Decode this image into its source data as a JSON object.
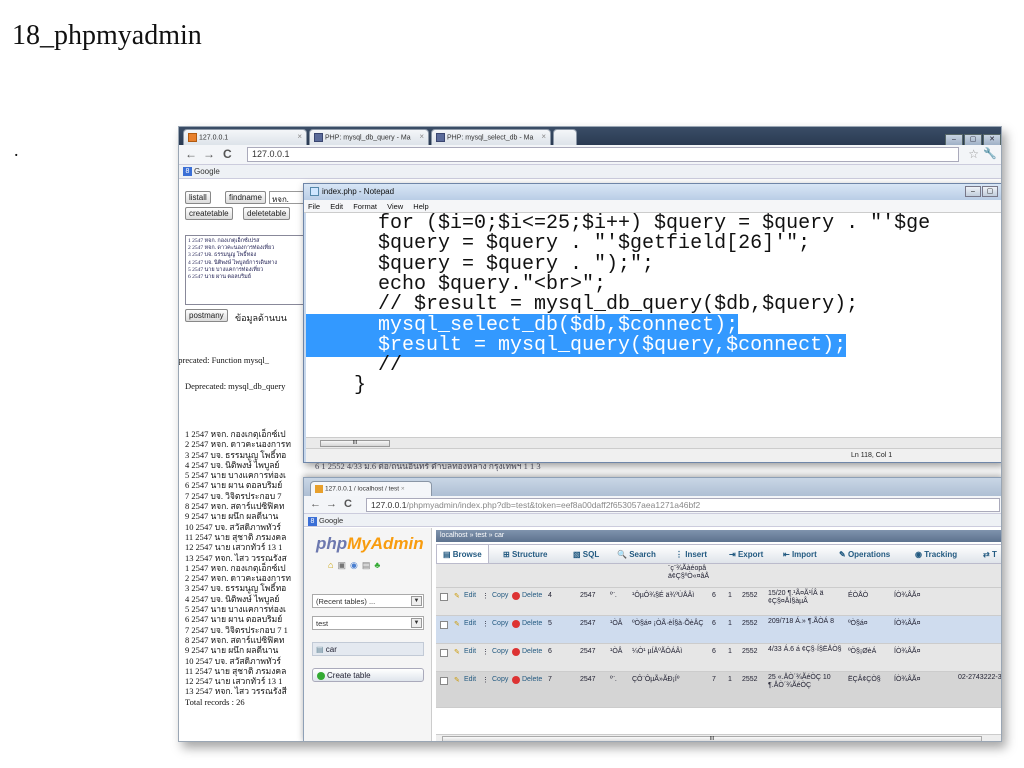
{
  "slide": {
    "title": "18_phpmyadmin",
    "bullet": "."
  },
  "browser": {
    "tabs": [
      {
        "label": "127.0.0.1"
      },
      {
        "label": "PHP: mysql_db_query - Ma"
      },
      {
        "label": "PHP: mysql_select_db - Ma"
      }
    ],
    "url": "127.0.0.1",
    "bookmark": "Google",
    "nav_back": "←",
    "nav_forward": "→",
    "nav_reload": "C"
  },
  "back_page": {
    "buttons": {
      "listall": "listall",
      "findname": "findname",
      "createtable": "createtable",
      "deletetable": "deletetable",
      "postmany": "postmany"
    },
    "find_input": "หจก.",
    "listbox_items": [
      "1 2547 หจก. กองเกตุเอ็กซ์เปรส",
      "2 2547 หจก. ดาวคะนองการท่องเที่ยว",
      "3 2547 บจ. ธรรมนูญ โพธิ์ทอง",
      "4 2547 บจ. นิติพงษ์ ไพบูลย์การเดินทาง",
      "5 2547 นาย บางแคการท่องเที่ยว",
      "6 2547 นาย ผาน ตอลบริมย์"
    ],
    "postmany_label": "ข้อมูลด้านบน",
    "deprecated_1": "Deprecated: Function mysql_",
    "deprecated_2": "Deprecated: mysql_db_query",
    "line_6_tail": "6 1 2552 4/33 ม.6 ต่อ/ถนนอินทร์ ตำบลทองหลาง กรุงเทพฯ 1 1 3",
    "records": [
      "1 2547 หจก. กองเกตุเอ็กซ์เป",
      "2 2547 หจก. ดาวคะนองการท",
      "3 2547 บจ. ธรรมนูญ โพธิ์ทอ",
      "4 2547 บจ. นิติพงษ์ ไพบูลย์",
      "5 2547 นาย บางแคการท่องเ",
      "6 2547 นาย ผาน ตอลบริมย์",
      "7 2547 บจ. วิจิตรประกอบ 7",
      "8 2547 หจก. สตาร์แปซิฟิคท",
      "9 2547 นาย ผนึก ผลดีนาน",
      "10 2547 บจ. สวัสดิภาพทัวร์",
      "11 2547 นาย สุชาติ ภรมงคล",
      "12 2547 นาย เสวกทัวร์ 13 1",
      "13 2547 หจก. ไสว วรรณรังส",
      "1 2547 หจก. กองเกตุเอ็กซ์เป",
      "2 2547 หจก. ดาวคะนองการท",
      "3 2547 บจ. ธรรมนูญ โพธิ์ทอ",
      "4 2547 บจ. นิติพงษ์ ไพบูลย์",
      "5 2547 นาย บางแคการท่องเ",
      "6 2547 นาย ผาน ตอลบริมย์",
      "7 2547 บจ. วิจิตรประกอบ 7 1",
      "8 2547 หจก. สตาร์แปซิฟิคท",
      "9 2547 นาย ผนึก ผลดีนาน",
      "10 2547 บจ. สวัสดิภาพทัวร์",
      "11 2547 นาย สุชาติ ภรมงคล",
      "12 2547 นาย เสวกทัวร์ 13 1",
      "13 2547 หจก. ไสว วรรณรังสี",
      "Total records : 26"
    ]
  },
  "notepad": {
    "title": "index.php - Notepad",
    "menu": [
      "File",
      "Edit",
      "Format",
      "View",
      "Help"
    ],
    "lines": [
      {
        "text": "      for ($i=0;$i<=25;$i++) $query = $query . \"'$ge",
        "selected": false
      },
      {
        "text": "      $query = $query . \"'$getfield[26]'\";",
        "selected": false
      },
      {
        "text": "      $query = $query . \");\";",
        "selected": false
      },
      {
        "text": "      echo $query.\"<br>\";",
        "selected": false
      },
      {
        "text": "      // $result = mysql_db_query($db,$query);",
        "selected": false
      },
      {
        "text": "      mysql_select_db($db,$connect);",
        "selected": true
      },
      {
        "text": "      $result = mysql_query($query,$connect);",
        "selected": true
      },
      {
        "text": "      //",
        "selected": false
      },
      {
        "text": "    }",
        "selected": false
      }
    ],
    "scroll_thumb": "III",
    "status": "Ln 118, Col 1"
  },
  "pma": {
    "tab_label": "127.0.0.1 / localhost / test",
    "url_host": "127.0.0.1",
    "url_path": "/phpmyadmin/index.php?db=test&token=eef8a00daff2f653057aea1271a46bf2",
    "bookmark": "Google",
    "logo_php": "php",
    "logo_my": "MyAdmin",
    "recent_tables": "(Recent tables) ...",
    "db_select": "test",
    "table_item": "car",
    "create_table": "Create table",
    "breadcrumb": "localhost » test » car",
    "menu": [
      "Browse",
      "Structure",
      "SQL",
      "Search",
      "Insert",
      "Export",
      "Import",
      "Operations",
      "Tracking",
      "T"
    ],
    "row_actions": {
      "edit": "Edit",
      "copy": "Copy",
      "delete": "Delete"
    },
    "top_fragment": [
      "¨ç¨¾Ãàéopâ",
      "ä¢Ç§ºÒ«¤âÅ"
    ],
    "rows": [
      {
        "id": "4",
        "year": "2547",
        "c1": "º¨.",
        "c2": "¹ÔµÔ¾§É ä¾ºÙÅÂì",
        "c3": "6",
        "c4": "1",
        "c5": "2552",
        "addr": "15/20 ¶.¹Ã¤Ã¹ÍÂ ä ¢Ç§¤ÅÍ§àµÂ",
        "c7": "ÉÒÅÒ",
        "c8": "ÍÒ¾ÂÃ¤",
        "c9": ""
      },
      {
        "id": "5",
        "year": "2547",
        "c1": "¹ÒÂ",
        "c2": "ºÒ§á¤ ¡ÒÃ·èÍ§à·ÕèÂÇ",
        "c3": "6",
        "c4": "1",
        "c5": "2552",
        "addr": "209/718 Á.» ¶.ÃÒÁ 8",
        "c7": "ºÒ§á¤",
        "c8": "ÍÒ¾ÂÃ¤",
        "c9": ""
      },
      {
        "id": "6",
        "year": "2547",
        "c1": "¹ÒÂ",
        "c2": "¼Ò¹ µÍÅºÃÔÁÂì",
        "c3": "6",
        "c4": "1",
        "c5": "2552",
        "addr": "4/33 Á.6 á ¢Ç§·Í§ËÅÒ§",
        "c7": "ºÖ§¡ØèÁ",
        "c8": "ÍÒ¾ÂÃ¤",
        "c9": ""
      },
      {
        "id": "7",
        "year": "2547",
        "c1": "º¨.",
        "c2": "ÇÔ¨ÔµÃ»ÃÐ¡Íº",
        "c3": "7",
        "c4": "1",
        "c5": "2552",
        "addr": "25 «.ÅÒ´¾ÃéÒÇ 10 ¶.ÅÒ´¾ÃéÒÇ",
        "c7": "ËÇÂ¢ÇÒ§",
        "c8": "ÍÒ¾ÂÃ¤",
        "c9": "02-2743222-3"
      }
    ],
    "scroll_thumb": "III"
  }
}
